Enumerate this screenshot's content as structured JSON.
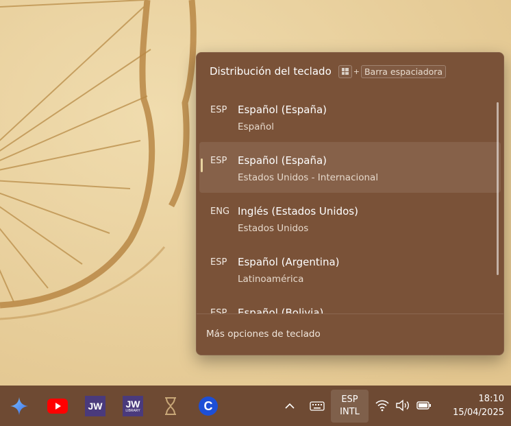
{
  "flyout": {
    "title": "Distribución del teclado",
    "shortcut_plus": "+",
    "shortcut_key": "Barra espaciadora",
    "layouts": [
      {
        "code": "ESP",
        "name": "Español (España)",
        "sub": "Español",
        "selected": false
      },
      {
        "code": "ESP",
        "name": "Español (España)",
        "sub": "Estados Unidos - Internacional",
        "selected": true
      },
      {
        "code": "ENG",
        "name": "Inglés (Estados Unidos)",
        "sub": "Estados Unidos",
        "selected": false
      },
      {
        "code": "ESP",
        "name": "Español (Argentina)",
        "sub": "Latinoamérica",
        "selected": false
      },
      {
        "code": "ESP",
        "name": "Español (Bolivia)",
        "sub": "",
        "selected": false
      }
    ],
    "footer_link": "Más opciones de teclado"
  },
  "taskbar": {
    "apps": [
      {
        "icon": "copilot-icon"
      },
      {
        "icon": "youtube-icon"
      },
      {
        "icon": "jw-library-icon",
        "label": "JW"
      },
      {
        "icon": "jw-library-sign-icon",
        "label": "JW",
        "sub": "LIBRARY"
      },
      {
        "icon": "hourglass-icon"
      },
      {
        "icon": "ccleaner-icon",
        "label": "C"
      }
    ],
    "tray": {
      "lang_code": "ESP",
      "lang_layout": "INTL",
      "time": "18:10",
      "date": "15/04/2025"
    }
  },
  "colors": {
    "flyout_bg": "#7a5238",
    "taskbar_bg": "#6e4a33",
    "wallpaper": "#e9d2a2",
    "accent": "#e8d3a0"
  }
}
